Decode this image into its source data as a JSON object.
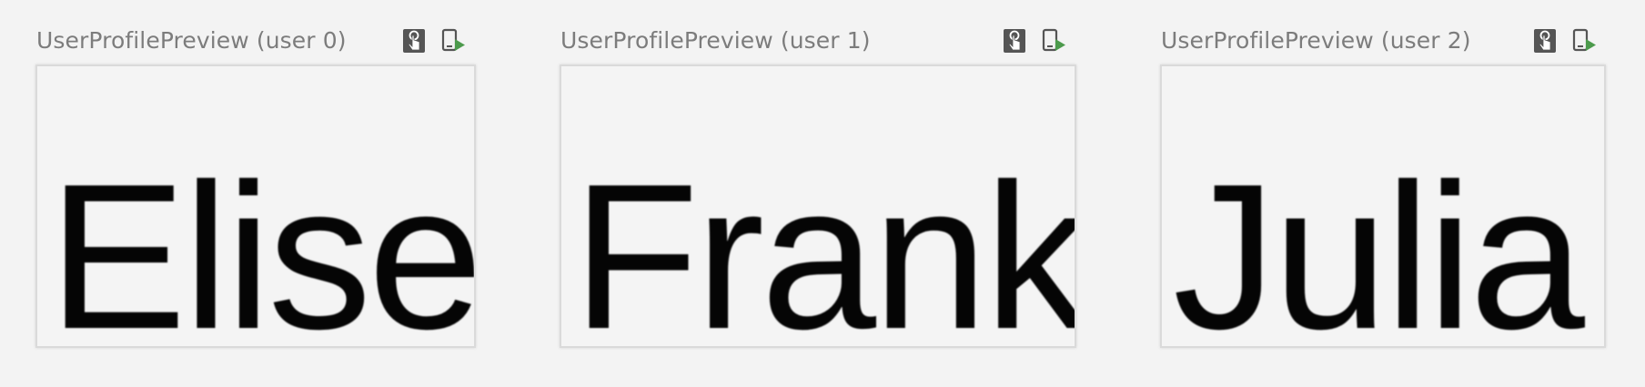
{
  "previews": [
    {
      "title": "UserProfilePreview (user 0)",
      "name": "Elise"
    },
    {
      "title": "UserProfilePreview (user 1)",
      "name": "Frank"
    },
    {
      "title": "UserProfilePreview (user 2)",
      "name": "Julia"
    }
  ],
  "icons": {
    "interactive": "interactive-mode-icon",
    "deploy": "run-on-device-icon"
  },
  "colors": {
    "background": "#f3f3f3",
    "title": "#7c7c7c",
    "deploy_arrow": "#4c9a4c",
    "icon_dark": "#555555"
  }
}
